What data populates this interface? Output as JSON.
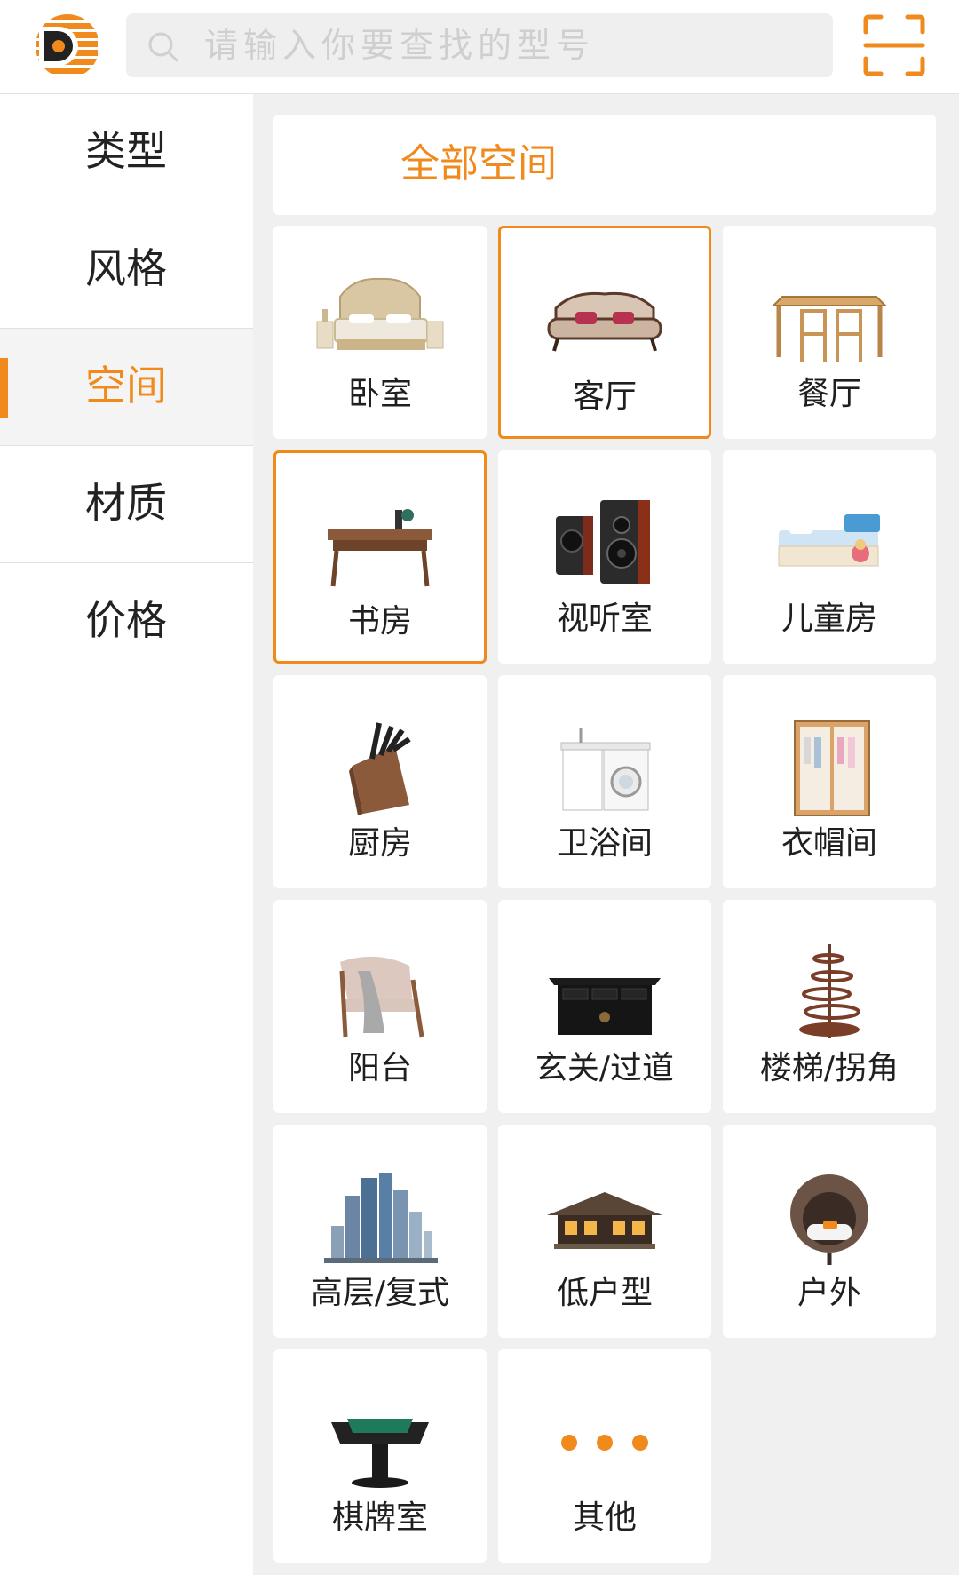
{
  "header": {
    "search_placeholder": "请输入你要查找的型号"
  },
  "sidebar": {
    "items": [
      {
        "label": "类型"
      },
      {
        "label": "风格"
      },
      {
        "label": "空间"
      },
      {
        "label": "材质"
      },
      {
        "label": "价格"
      }
    ],
    "active_index": 2
  },
  "content": {
    "all_label": "全部空间",
    "tiles": [
      {
        "label": "卧室",
        "icon": "bed-icon"
      },
      {
        "label": "客厅",
        "icon": "sofa-icon"
      },
      {
        "label": "餐厅",
        "icon": "dining-table-icon"
      },
      {
        "label": "书房",
        "icon": "desk-icon"
      },
      {
        "label": "视听室",
        "icon": "speaker-icon"
      },
      {
        "label": "儿童房",
        "icon": "kids-bed-icon"
      },
      {
        "label": "厨房",
        "icon": "knife-block-icon"
      },
      {
        "label": "卫浴间",
        "icon": "washing-machine-icon"
      },
      {
        "label": "衣帽间",
        "icon": "wardrobe-icon"
      },
      {
        "label": "阳台",
        "icon": "armchair-icon"
      },
      {
        "label": "玄关/过道",
        "icon": "console-cabinet-icon"
      },
      {
        "label": "楼梯/拐角",
        "icon": "spiral-stair-icon"
      },
      {
        "label": "高层/复式",
        "icon": "skyscraper-icon"
      },
      {
        "label": "低户型",
        "icon": "house-icon"
      },
      {
        "label": "户外",
        "icon": "egg-chair-icon"
      },
      {
        "label": "棋牌室",
        "icon": "mahjong-table-icon"
      },
      {
        "label": "其他",
        "icon": "more-dots-icon"
      }
    ],
    "selected": [
      "客厅",
      "书房"
    ]
  },
  "colors": {
    "accent": "#f08a1d",
    "background": "#f0f0f0"
  }
}
